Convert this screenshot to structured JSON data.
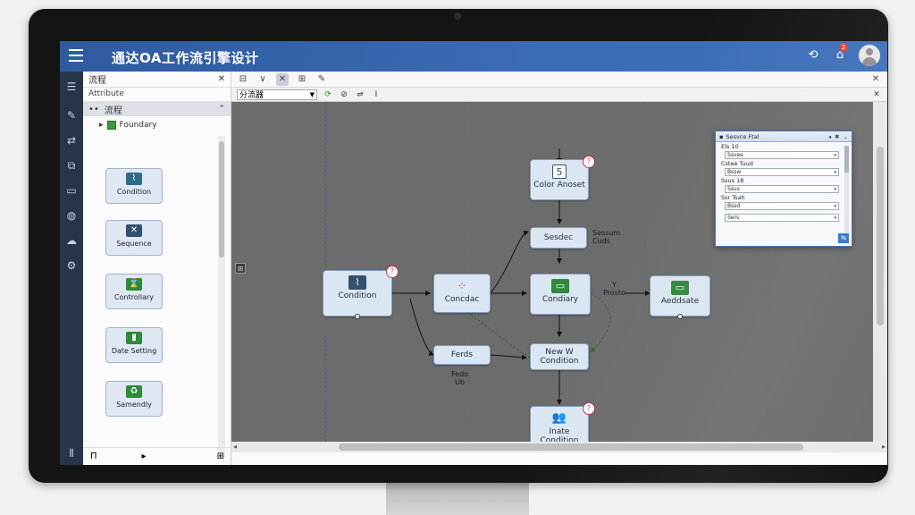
{
  "window": {
    "title": "通达OA工作流引擎设计",
    "header_icons": [
      "refresh-icon",
      "notification-icon",
      "user-avatar"
    ],
    "notification_count": "2"
  },
  "rail": {
    "icons": [
      "list-icon",
      "pen-icon",
      "flow-icon",
      "copy-icon",
      "folder-icon",
      "globe-icon",
      "cloud-icon",
      "settings-icon",
      "grid-icon"
    ]
  },
  "palette": {
    "title": "流程",
    "search_label": "Attribute",
    "group_label": "流程",
    "tree_item": "Foundary",
    "items": [
      {
        "label": "Condition",
        "icon": "chart-icon",
        "color": "#2e6b8a"
      },
      {
        "label": "Sequence",
        "icon": "cross-icon",
        "color": "#34506e"
      },
      {
        "label": "Controllary",
        "icon": "hourglass-icon",
        "color": "#2f8a3a"
      },
      {
        "label": "Date Setting",
        "icon": "bookmark-icon",
        "color": "#2f8a3a"
      },
      {
        "label": "Samendly",
        "icon": "recycle-icon",
        "color": "#2f8a3a"
      }
    ],
    "footer_left": "Π",
    "footer_mid": "▸",
    "footer_right": "⊞"
  },
  "toolbar": {
    "row1": [
      "⊟",
      "∨",
      "✕",
      "⊞",
      "✎"
    ],
    "row2_combo": "分流器",
    "row2_buttons": [
      "⟳",
      "⊘",
      "⇌",
      "I"
    ]
  },
  "canvas": {
    "nodes": [
      {
        "id": "n1",
        "label": "Condition",
        "icon": "chart-icon",
        "color": "#34506e",
        "badge": "?"
      },
      {
        "id": "n2",
        "label": "Concdac",
        "icon": "dots-icon",
        "color": "#ffffff"
      },
      {
        "id": "n3",
        "label": "Color Anoset",
        "sublabel": "5",
        "icon": "document-icon",
        "color": "#34506e",
        "badge": "?"
      },
      {
        "id": "n4",
        "label": "Sesdec",
        "icon": "",
        "color": ""
      },
      {
        "id": "n5",
        "label": "Condiary",
        "icon": "window-icon",
        "color": "#2f8a3a"
      },
      {
        "id": "n6",
        "label": "Aeddsate",
        "icon": "window-icon",
        "color": "#2f8a3a"
      },
      {
        "id": "n7",
        "label": "Ferds",
        "icon": "",
        "color": ""
      },
      {
        "id": "n8",
        "label": "New W Condition",
        "icon": "",
        "color": ""
      },
      {
        "id": "n9",
        "label": "Inate Condition",
        "icon": "users-icon",
        "color": "#34506e",
        "badge": "?"
      }
    ],
    "captions": [
      {
        "text": "Sessum\nCuds"
      },
      {
        "text": "Y\nProsto"
      },
      {
        "text": "Fedo\nUb"
      }
    ]
  },
  "properties": {
    "title": "Sesvce Ftal",
    "fields": [
      {
        "label": "Els 10",
        "value": "Ssvee"
      },
      {
        "label": "Cstee Tuud",
        "value": "Bssw"
      },
      {
        "label": "Ssus 18",
        "value": "Ssus"
      },
      {
        "label": "Ssr Tsah",
        "value": "Bssd"
      },
      {
        "label": "",
        "value": "Sers"
      }
    ],
    "ok_label": "⇆"
  }
}
